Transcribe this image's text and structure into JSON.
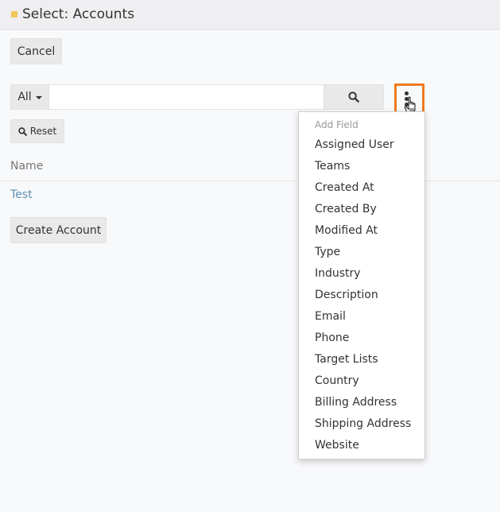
{
  "header": {
    "title": "Select: Accounts"
  },
  "buttons": {
    "cancel": "Cancel",
    "filter_all": "All",
    "reset": "Reset",
    "create": "Create Account"
  },
  "search": {
    "value": "",
    "placeholder": ""
  },
  "list": {
    "column_name": "Name",
    "rows": [
      "Test"
    ]
  },
  "dropdown": {
    "header": "Add Field",
    "items": [
      "Assigned User",
      "Teams",
      "Created At",
      "Created By",
      "Modified At",
      "Type",
      "Industry",
      "Description",
      "Email",
      "Phone",
      "Target Lists",
      "Country",
      "Billing Address",
      "Shipping Address",
      "Website"
    ]
  },
  "colors": {
    "accent_square": "#f0c65b",
    "link": "#5a8fb0",
    "highlight_border": "#f07a1e"
  },
  "icons": {
    "search": "search-icon",
    "options": "vertical-dots-icon",
    "cursor": "hand-pointer-icon",
    "caret": "caret-down-icon"
  }
}
